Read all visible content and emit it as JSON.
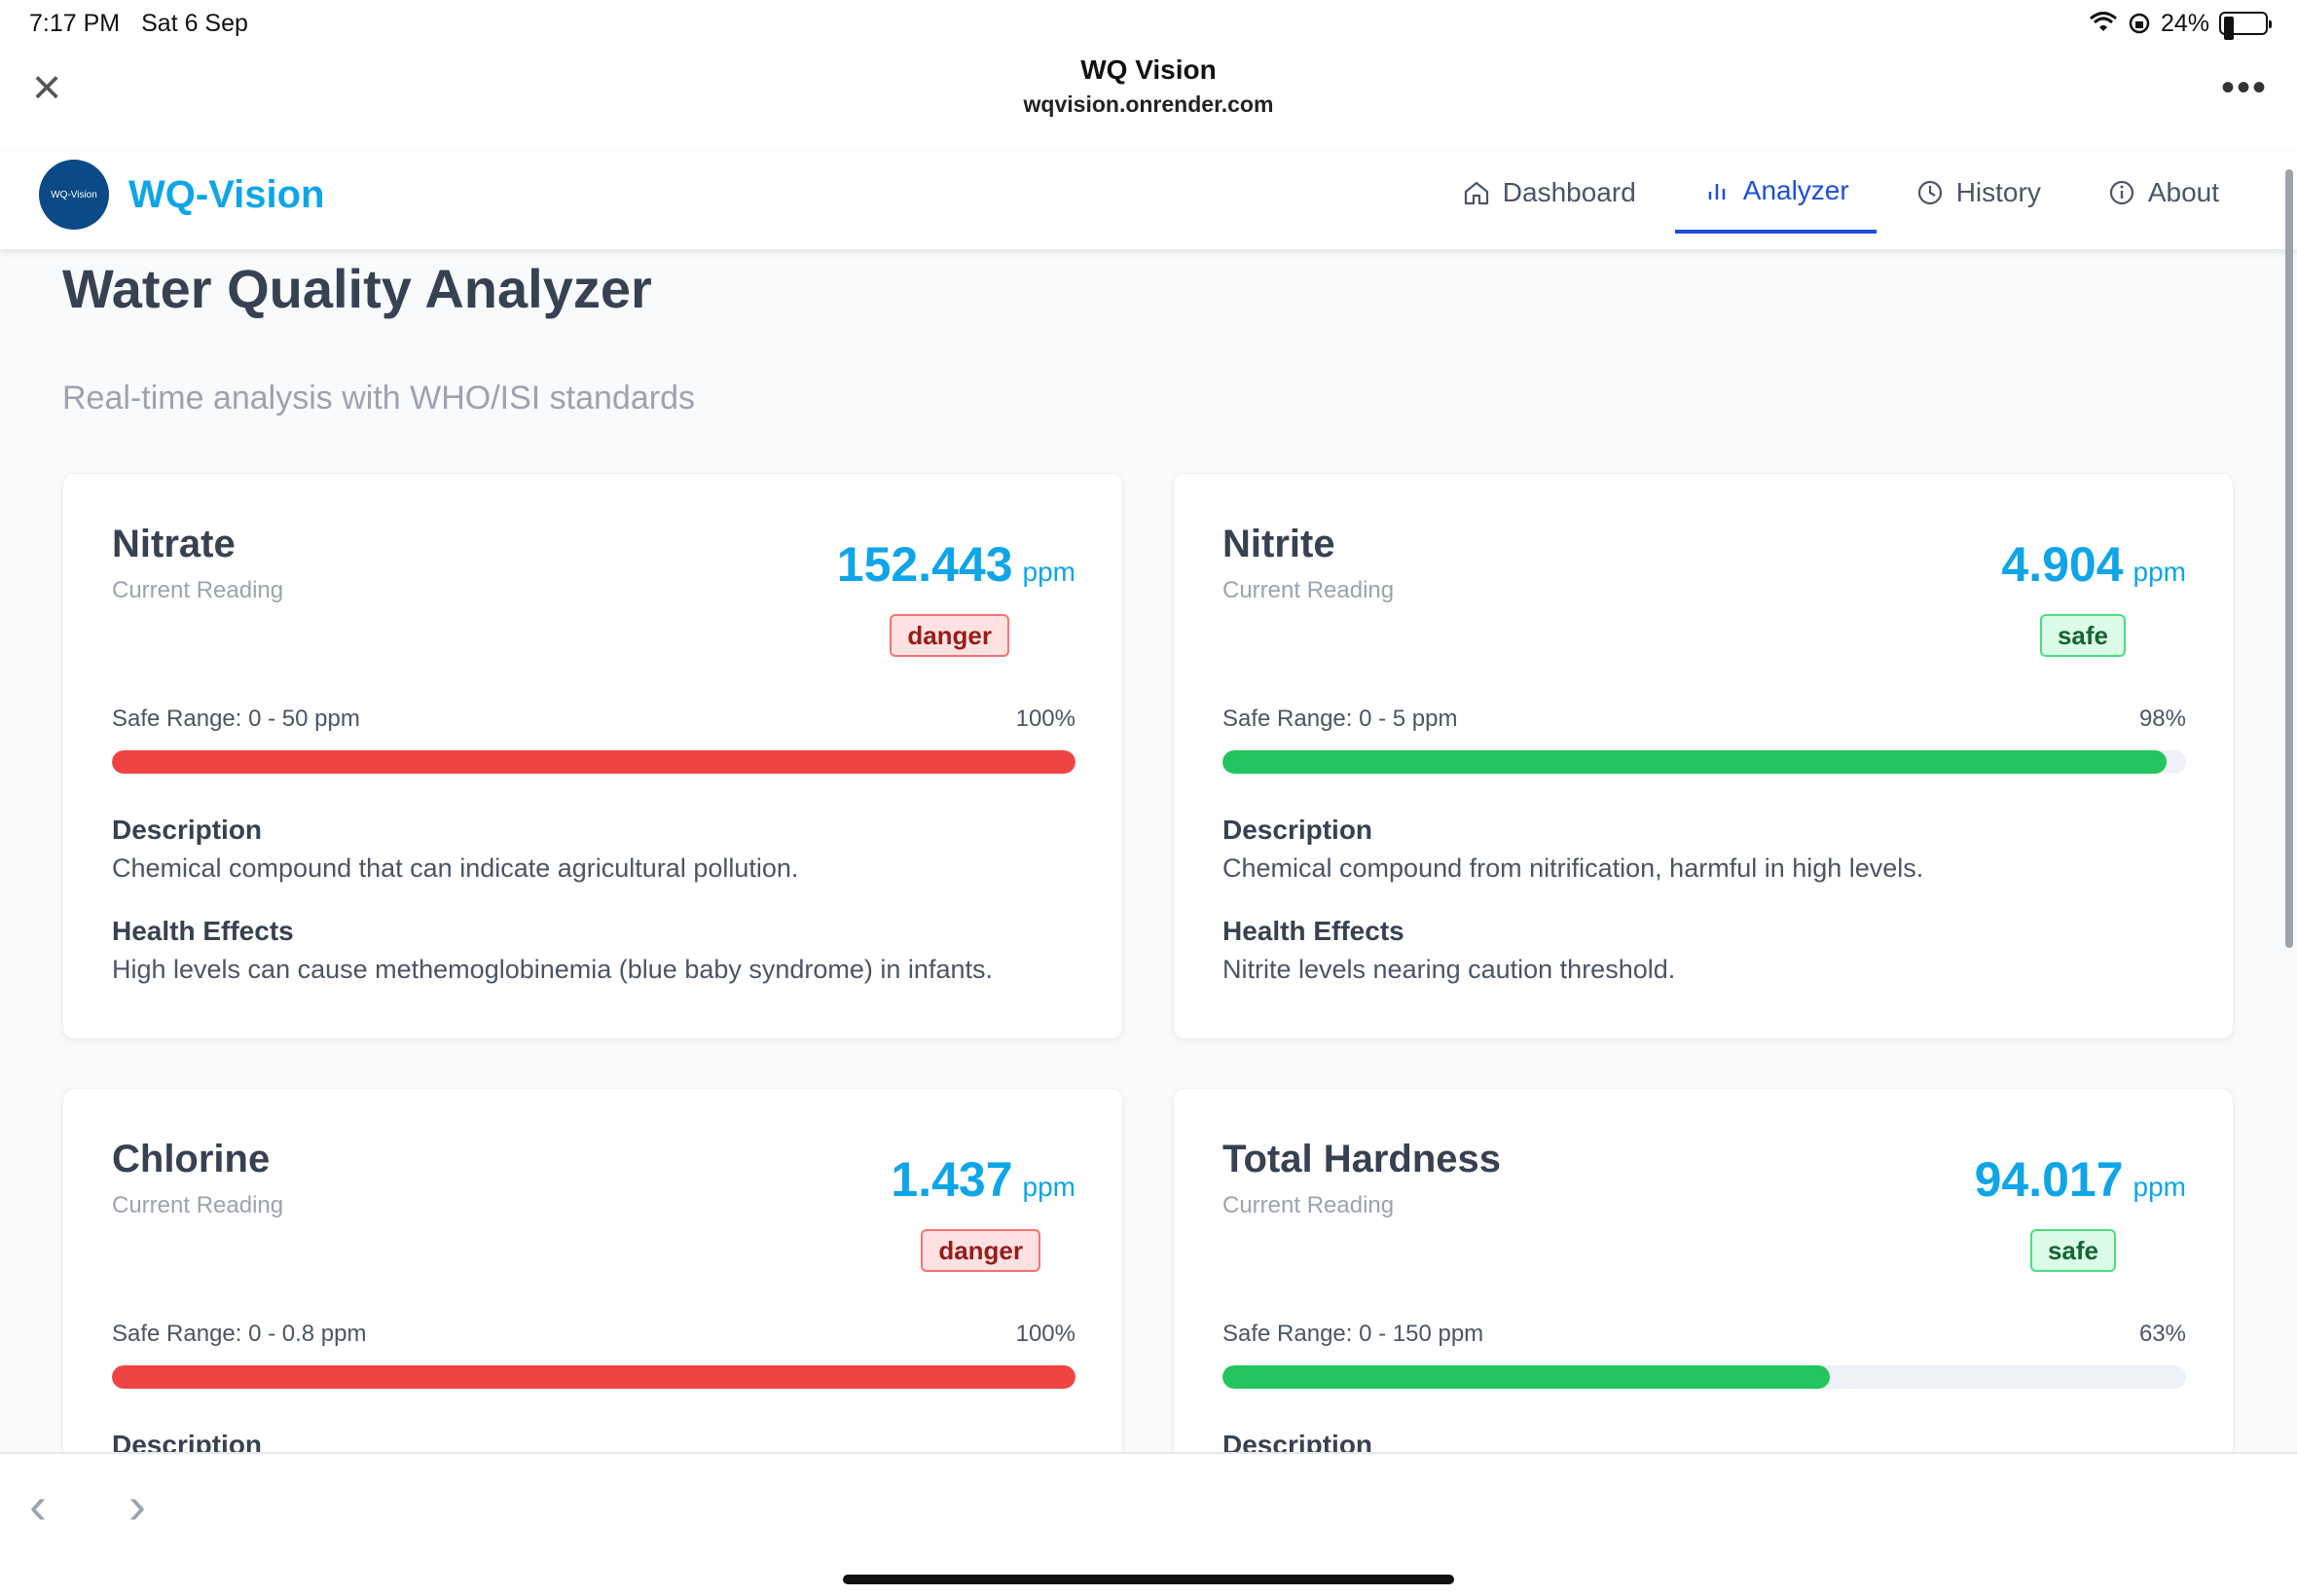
{
  "status_bar": {
    "time": "7:17 PM",
    "date": "Sat 6 Sep",
    "battery": "24%"
  },
  "browser": {
    "title": "WQ Vision",
    "url": "wqvision.onrender.com"
  },
  "app": {
    "logo_text": "WQ-Vision",
    "brand": "WQ-Vision",
    "nav": [
      {
        "label": "Dashboard",
        "icon": "home-icon"
      },
      {
        "label": "Analyzer",
        "icon": "bar-chart-icon"
      },
      {
        "label": "History",
        "icon": "clock-icon"
      },
      {
        "label": "About",
        "icon": "info-icon"
      }
    ],
    "active_nav": "Analyzer"
  },
  "page": {
    "title": "Water Quality Analyzer",
    "subtitle": "Real-time analysis with WHO/ISI standards"
  },
  "cards": [
    {
      "name": "Nitrate",
      "sub": "Current Reading",
      "value": "152.443",
      "unit": "ppm",
      "status": "danger",
      "range": "Safe Range: 0 - 50 ppm",
      "percent": "100%",
      "fill_fraction": 1.0,
      "desc_label": "Description",
      "desc": "Chemical compound that can indicate agricultural pollution.",
      "health_label": "Health Effects",
      "health": "High levels can cause methemoglobinemia (blue baby syndrome) in infants."
    },
    {
      "name": "Nitrite",
      "sub": "Current Reading",
      "value": "4.904",
      "unit": "ppm",
      "status": "safe",
      "range": "Safe Range: 0 - 5 ppm",
      "percent": "98%",
      "fill_fraction": 0.98,
      "desc_label": "Description",
      "desc": "Chemical compound from nitrification, harmful in high levels.",
      "health_label": "Health Effects",
      "health": "Nitrite levels nearing caution threshold."
    },
    {
      "name": "Chlorine",
      "sub": "Current Reading",
      "value": "1.437",
      "unit": "ppm",
      "status": "danger",
      "range": "Safe Range: 0 - 0.8 ppm",
      "percent": "100%",
      "fill_fraction": 1.0,
      "desc_label": "Description"
    },
    {
      "name": "Total Hardness",
      "sub": "Current Reading",
      "value": "94.017",
      "unit": "ppm",
      "status": "safe",
      "range": "Safe Range: 0 - 150 ppm",
      "percent": "63%",
      "fill_fraction": 0.63,
      "desc_label": "Description"
    }
  ],
  "colors": {
    "accent": "#0ea5e9",
    "nav_active": "#1d4ed8",
    "danger": "#ef4444",
    "safe": "#22c55e"
  }
}
